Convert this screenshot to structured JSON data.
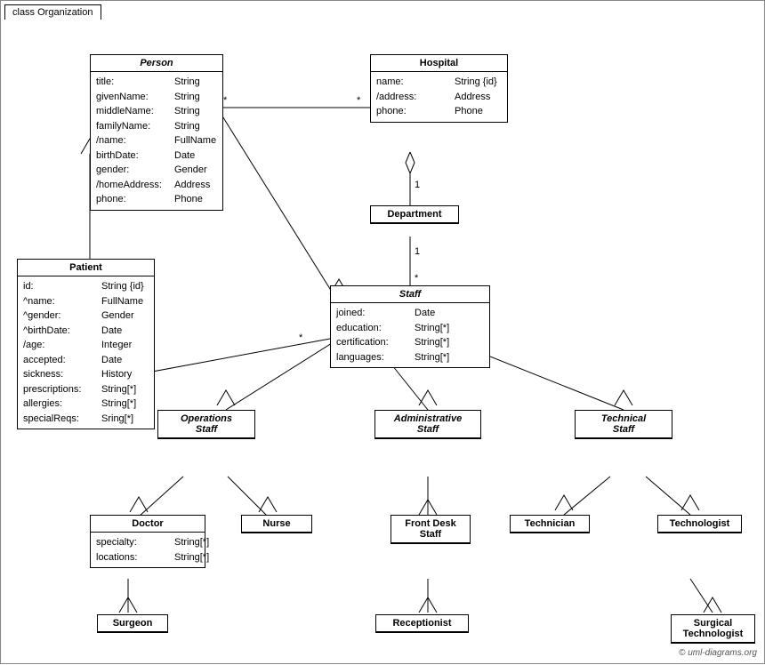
{
  "title": "class Organization",
  "copyright": "© uml-diagrams.org",
  "classes": {
    "person": {
      "label": "Person",
      "italic": true,
      "attrs": [
        [
          "title:",
          "String"
        ],
        [
          "givenName:",
          "String"
        ],
        [
          "middleName:",
          "String"
        ],
        [
          "familyName:",
          "String"
        ],
        [
          "/name:",
          "FullName"
        ],
        [
          "birthDate:",
          "Date"
        ],
        [
          "gender:",
          "Gender"
        ],
        [
          "/homeAddress:",
          "Address"
        ],
        [
          "phone:",
          "Phone"
        ]
      ]
    },
    "hospital": {
      "label": "Hospital",
      "italic": false,
      "attrs": [
        [
          "name:",
          "String {id}"
        ],
        [
          "/address:",
          "Address"
        ],
        [
          "phone:",
          "Phone"
        ]
      ]
    },
    "patient": {
      "label": "Patient",
      "italic": false,
      "attrs": [
        [
          "id:",
          "String {id}"
        ],
        [
          "^name:",
          "FullName"
        ],
        [
          "^gender:",
          "Gender"
        ],
        [
          "^birthDate:",
          "Date"
        ],
        [
          "/age:",
          "Integer"
        ],
        [
          "accepted:",
          "Date"
        ],
        [
          "sickness:",
          "History"
        ],
        [
          "prescriptions:",
          "String[*]"
        ],
        [
          "allergies:",
          "String[*]"
        ],
        [
          "specialReqs:",
          "Sring[*]"
        ]
      ]
    },
    "department": {
      "label": "Department",
      "italic": false,
      "attrs": []
    },
    "staff": {
      "label": "Staff",
      "italic": true,
      "attrs": [
        [
          "joined:",
          "Date"
        ],
        [
          "education:",
          "String[*]"
        ],
        [
          "certification:",
          "String[*]"
        ],
        [
          "languages:",
          "String[*]"
        ]
      ]
    },
    "operations_staff": {
      "label": "Operations\nStaff",
      "italic": true,
      "attrs": []
    },
    "administrative_staff": {
      "label": "Administrative\nStaff",
      "italic": true,
      "attrs": []
    },
    "technical_staff": {
      "label": "Technical\nStaff",
      "italic": true,
      "attrs": []
    },
    "doctor": {
      "label": "Doctor",
      "italic": false,
      "attrs": [
        [
          "specialty:",
          "String[*]"
        ],
        [
          "locations:",
          "String[*]"
        ]
      ]
    },
    "nurse": {
      "label": "Nurse",
      "italic": false,
      "attrs": []
    },
    "front_desk_staff": {
      "label": "Front Desk\nStaff",
      "italic": false,
      "attrs": []
    },
    "technician": {
      "label": "Technician",
      "italic": false,
      "attrs": []
    },
    "technologist": {
      "label": "Technologist",
      "italic": false,
      "attrs": []
    },
    "surgeon": {
      "label": "Surgeon",
      "italic": false,
      "attrs": []
    },
    "receptionist": {
      "label": "Receptionist",
      "italic": false,
      "attrs": []
    },
    "surgical_technologist": {
      "label": "Surgical\nTechnologist",
      "italic": false,
      "attrs": []
    }
  }
}
